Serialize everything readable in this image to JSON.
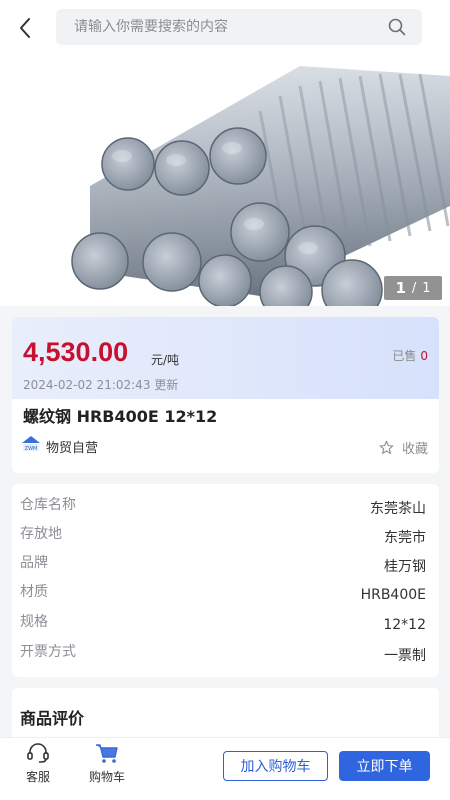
{
  "search": {
    "placeholder": "请输入你需要搜索的内容"
  },
  "gallery": {
    "current": "1",
    "separator": "/",
    "total": "1"
  },
  "product": {
    "price": "4,530.00",
    "price_unit": "元/吨",
    "sold_label": "已售",
    "sold_count": "0",
    "updated": "2024-02-02 21:02:43 更新",
    "name": "螺纹钢 HRB400E 12*12",
    "seller": "物贸自营",
    "favorite_label": "收藏"
  },
  "specs": [
    {
      "label": "仓库名称",
      "value": "东莞茶山"
    },
    {
      "label": "存放地",
      "value": "东莞市"
    },
    {
      "label": "品牌",
      "value": "桂万钢"
    },
    {
      "label": "材质",
      "value": "HRB400E"
    },
    {
      "label": "规格",
      "value": "12*12"
    },
    {
      "label": "开票方式",
      "value": "一票制"
    }
  ],
  "reviews": {
    "title": "商品评价"
  },
  "bottom_bar": {
    "service_label": "客服",
    "cart_label": "购物车",
    "add_to_cart": "加入购物车",
    "buy_now": "立即下单"
  },
  "colors": {
    "price_red": "#c8102e",
    "primary_blue": "#2f66e0",
    "header_band": "#dfe7fb"
  }
}
